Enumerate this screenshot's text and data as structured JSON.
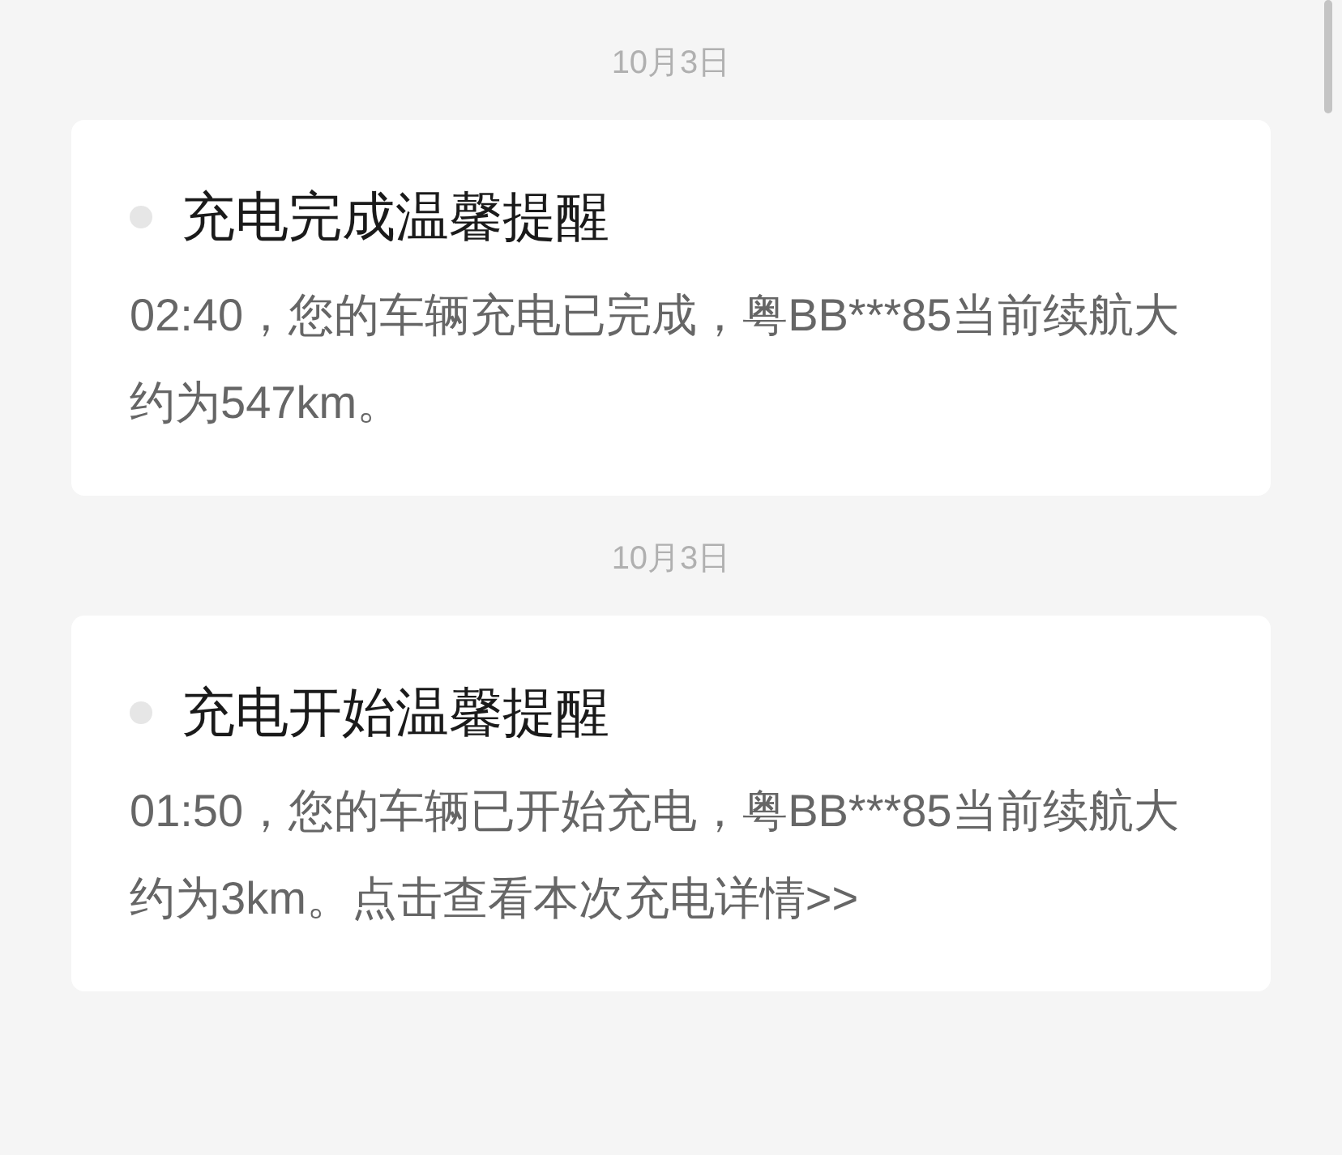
{
  "messages": [
    {
      "date": "10月3日",
      "title": "充电完成温馨提醒",
      "body": "02:40，您的车辆充电已完成，粤BB***85当前续航大约为547km。"
    },
    {
      "date": "10月3日",
      "title": "充电开始温馨提醒",
      "body": "01:50，您的车辆已开始充电，粤BB***85当前续航大约为3km。",
      "link": "点击查看本次充电详情>>"
    }
  ]
}
